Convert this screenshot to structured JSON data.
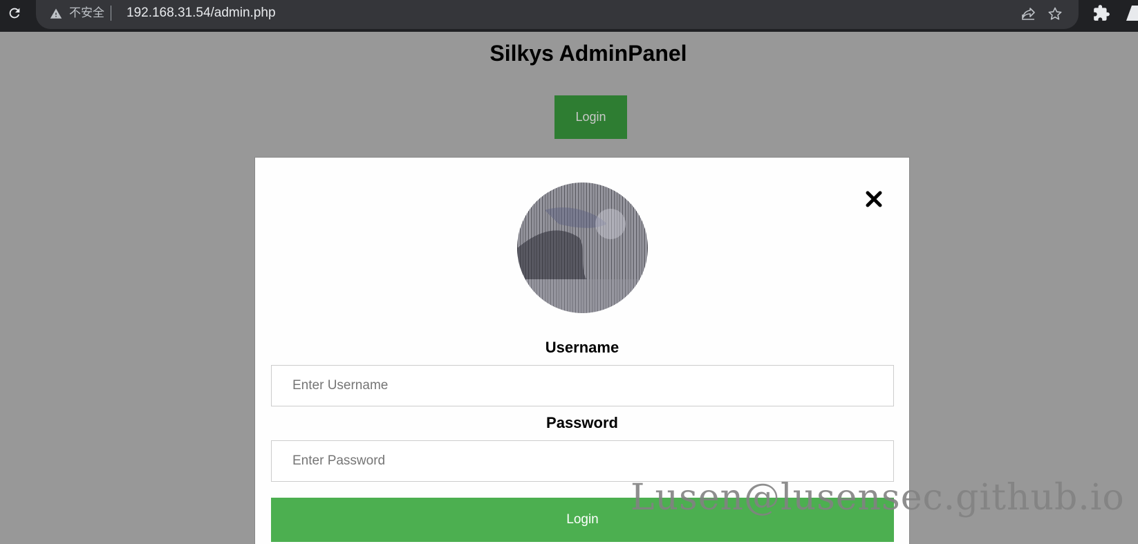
{
  "browser": {
    "security_label": "不安全",
    "url": "192.168.31.54/admin.php",
    "icons": [
      "reload-icon",
      "warning-icon",
      "share-icon",
      "star-icon",
      "extensions-icon",
      "profile-icon"
    ]
  },
  "page": {
    "title": "Silkys AdminPanel",
    "open_login_label": "Login"
  },
  "modal": {
    "username_label": "Username",
    "username_placeholder": "Enter Username",
    "username_value": "",
    "password_label": "Password",
    "password_placeholder": "Enter Password",
    "password_value": "",
    "submit_label": "Login",
    "close_icon": "close-icon"
  },
  "watermark": "Lusen@lusensec.github.io",
  "colors": {
    "background": "#989898",
    "primary_button": "#4caf50",
    "dark_button": "#2e7d32"
  }
}
